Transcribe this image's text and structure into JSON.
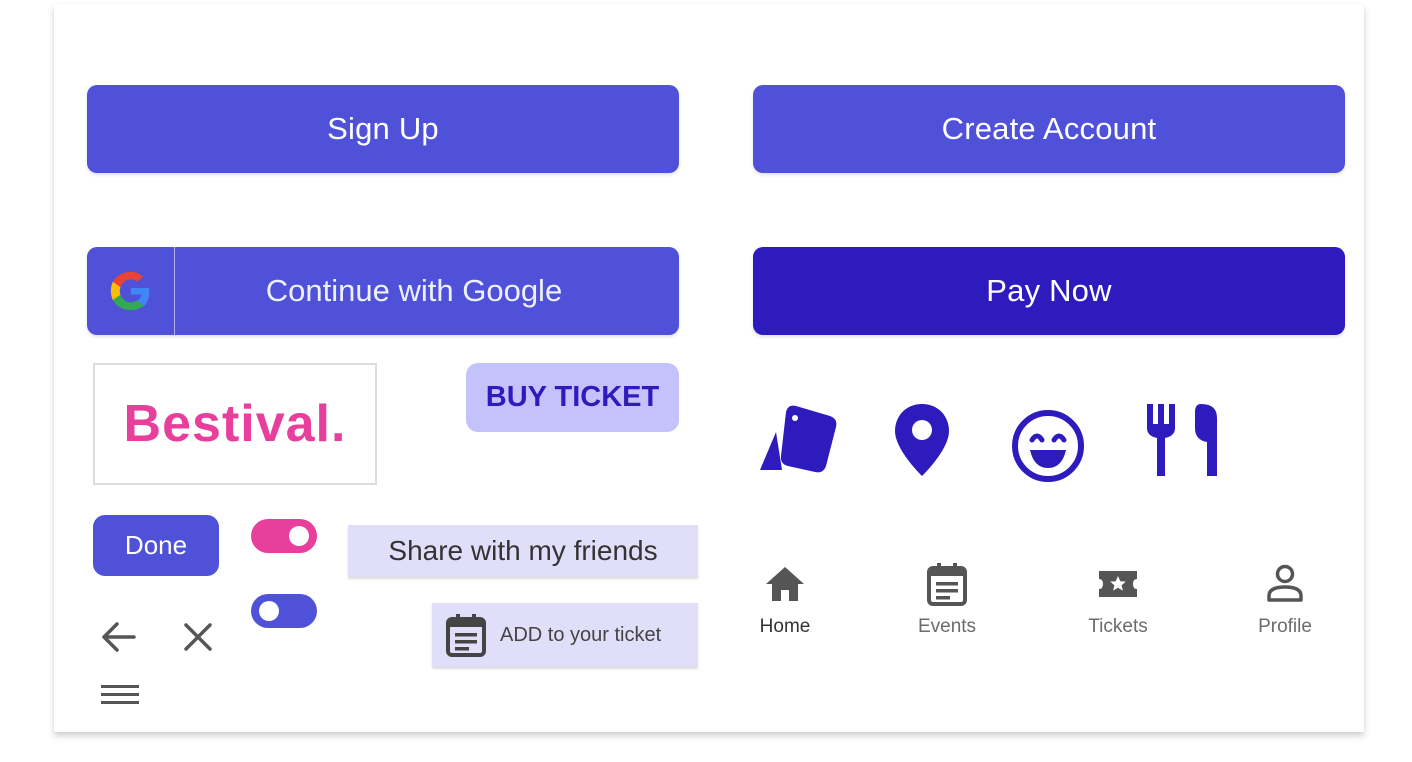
{
  "buttons": {
    "sign_up": "Sign Up",
    "create_account": "Create Account",
    "continue_google": "Continue with Google",
    "pay_now": "Pay Now",
    "buy_ticket": "BUY TICKET",
    "done": "Done",
    "share": "Share with my friends",
    "add_ticket": "ADD to your ticket"
  },
  "logo": {
    "text": "Bestival."
  },
  "feature_icons": [
    "tickets-icon",
    "location-pin-icon",
    "smiley-icon",
    "restaurant-icon"
  ],
  "toggles": [
    {
      "state": "on",
      "color": "#e93f9c"
    },
    {
      "state": "off",
      "color": "#4f51d8"
    }
  ],
  "bottom_nav": {
    "items": [
      {
        "label": "Home",
        "icon": "home-icon",
        "active": true
      },
      {
        "label": "Events",
        "icon": "calendar-icon",
        "active": false
      },
      {
        "label": "Tickets",
        "icon": "ticket-star-icon",
        "active": false
      },
      {
        "label": "Profile",
        "icon": "person-icon",
        "active": false
      }
    ]
  },
  "colors": {
    "primary": "#4f51d8",
    "dark": "#2e1bbd",
    "accent_pink": "#e93f9c",
    "light_lavender": "#c4c2fb",
    "pale_lavender": "#e0def8"
  }
}
